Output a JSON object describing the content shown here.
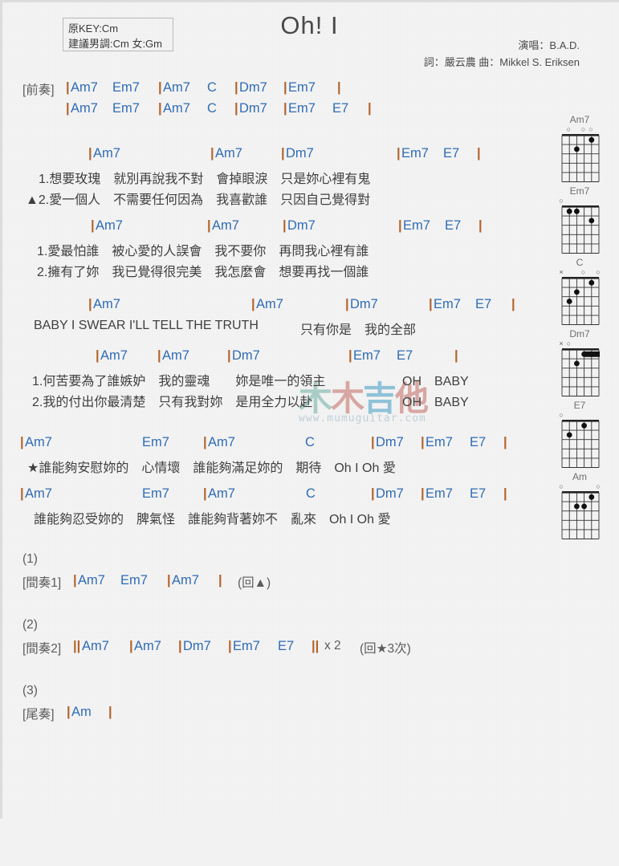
{
  "header": {
    "key_line1": "原KEY:Cm",
    "key_line2": "建議男調:Cm 女:Gm",
    "title": "Oh! I",
    "singer": "演唱：B.A.D.",
    "writers": "詞：嚴云農  曲：Mikkel S. Eriksen"
  },
  "watermark": {
    "c1": "木",
    "c2": "木",
    "c3": "吉",
    "c4": "他",
    "url": "www.mumuguitar.com"
  },
  "sections": {
    "intro": {
      "label": "[前奏]",
      "line1": {
        "bar1": "|",
        "c1": "Am7",
        "c2": "Em7",
        "bar2": "|",
        "c3": "Am7",
        "c4": "C",
        "bar3": "|",
        "c5": "Dm7",
        "bar4": "|",
        "c6": "Em7",
        "bar5": "|"
      },
      "line2": {
        "bar1": "|",
        "c1": "Am7",
        "c2": "Em7",
        "bar2": "|",
        "c3": "Am7",
        "c4": "C",
        "bar3": "|",
        "c5": "Dm7",
        "bar4": "|",
        "c6": "Em7",
        "c7": "E7",
        "bar5": "|"
      }
    },
    "verseA": {
      "chords": {
        "bar1": "|",
        "c1": "Am7",
        "bar2": "|",
        "c2": "Am7",
        "bar3": "|",
        "c3": "Dm7",
        "bar4": "|",
        "c4": "Em7",
        "c5": "E7",
        "bar5": "|"
      },
      "lyric1": "1.想要玫瑰　就別再說我不對　會掉眼淚　只是妳心裡有鬼",
      "lyric2": "▲2.愛一個人　不需要任何因為　我喜歡誰　只因自己覺得對"
    },
    "verseB": {
      "chords": {
        "bar1": "|",
        "c1": "Am7",
        "bar2": "|",
        "c2": "Am7",
        "bar3": "|",
        "c3": "Dm7",
        "bar4": "|",
        "c4": "Em7",
        "c5": "E7",
        "bar5": "|"
      },
      "lyric1": "1.愛最怕誰　被心愛的人誤會　我不要你　再問我心裡有誰",
      "lyric2": "2.擁有了妳　我已覺得很完美　我怎麼會　想要再找一個誰"
    },
    "preChorus": {
      "chords": {
        "bar1": "|",
        "c1": "Am7",
        "bar2": "|",
        "c2": "Am7",
        "bar3": "|",
        "c3": "Dm7",
        "bar4": "|",
        "c4": "Em7",
        "c5": "E7",
        "bar5": "|"
      },
      "lyric_en": "BABY I SWEAR I'LL TELL THE TRUTH",
      "lyric_cn": "只有你是　我的全部"
    },
    "verseC": {
      "chords": {
        "bar1": "|",
        "c1": "Am7",
        "bar2": "|",
        "c2": "Am7",
        "bar3": "|",
        "c3": "Dm7",
        "bar4": "|",
        "c4": "Em7",
        "c5": "E7",
        "bar5": "|"
      },
      "lyric1": "1.何苦要為了誰嫉妒　我的靈魂　　妳是唯一的領主",
      "lyric1_tail": "OH　BABY",
      "lyric2": "2.我的付出你最清楚　只有我對妳　是用全力以赴",
      "lyric2_tail": "OH　BABY"
    },
    "chorus1": {
      "chords": {
        "bar1": "|",
        "c1": "Am7",
        "c2": "Em7",
        "bar2": "|",
        "c3": "Am7",
        "c4": "C",
        "bar3": "|",
        "c5": "Dm7",
        "bar4": "|",
        "c6": "Em7",
        "c7": "E7",
        "bar5": "|"
      },
      "lyric": "★誰能夠安慰妳的　心情壞　誰能夠滿足妳的　期待　Oh I Oh 愛"
    },
    "chorus2": {
      "chords": {
        "bar1": "|",
        "c1": "Am7",
        "c2": "Em7",
        "bar2": "|",
        "c3": "Am7",
        "c4": "C",
        "bar3": "|",
        "c5": "Dm7",
        "bar4": "|",
        "c6": "Em7",
        "c7": "E7",
        "bar5": "|"
      },
      "lyric": "誰能夠忍受妳的　脾氣怪　誰能夠背著妳不　亂來　Oh I Oh 愛"
    },
    "ending1": {
      "number": "(1)",
      "label": "[間奏1]",
      "bar1": "|",
      "c1": "Am7",
      "c2": "Em7",
      "bar2": "|",
      "c3": "Am7",
      "bar3": "|",
      "note": "(回▲)"
    },
    "ending2": {
      "number": "(2)",
      "label": "[間奏2]",
      "bar1": "||",
      "c1": "Am7",
      "bar2": "|",
      "c2": "Am7",
      "bar3": "|",
      "c3": "Dm7",
      "bar4": "|",
      "c4": "Em7",
      "c5": "E7",
      "bar5": "||",
      "repeat": "x 2",
      "note": "(回★3次)"
    },
    "ending3": {
      "number": "(3)",
      "label": "[尾奏]",
      "bar1": "|",
      "c1": "Am",
      "bar2": "|"
    }
  },
  "chord_diagrams": [
    {
      "name": "Am7",
      "markers": [
        "",
        "o",
        "",
        "o",
        "o",
        ""
      ],
      "dots": [
        {
          "s": 4,
          "f": 2
        },
        {
          "s": 2,
          "f": 1
        }
      ],
      "barre": null
    },
    {
      "name": "Em7",
      "markers": [
        "o",
        "",
        "",
        "",
        "",
        ""
      ],
      "dots": [
        {
          "s": 5,
          "f": 1
        },
        {
          "s": 4,
          "f": 1
        },
        {
          "s": 2,
          "f": 2
        }
      ],
      "barre": null
    },
    {
      "name": "C",
      "markers": [
        "x",
        "",
        "",
        "o",
        "",
        "o"
      ],
      "dots": [
        {
          "s": 5,
          "f": 3
        },
        {
          "s": 4,
          "f": 2
        },
        {
          "s": 2,
          "f": 1
        }
      ],
      "barre": null
    },
    {
      "name": "Dm7",
      "markers": [
        "x",
        "o",
        "",
        "",
        "",
        ""
      ],
      "dots": [
        {
          "s": 4,
          "f": 2
        }
      ],
      "barre": {
        "f": 1,
        "from": 3,
        "to": 1
      }
    },
    {
      "name": "E7",
      "markers": [
        "o",
        "",
        "",
        "",
        "",
        ""
      ],
      "dots": [
        {
          "s": 5,
          "f": 2
        },
        {
          "s": 3,
          "f": 1
        }
      ],
      "barre": null
    },
    {
      "name": "Am",
      "markers": [
        "o",
        "",
        "",
        "",
        "",
        "o"
      ],
      "dots": [
        {
          "s": 4,
          "f": 2
        },
        {
          "s": 3,
          "f": 2
        },
        {
          "s": 2,
          "f": 1
        }
      ],
      "barre": null
    }
  ]
}
